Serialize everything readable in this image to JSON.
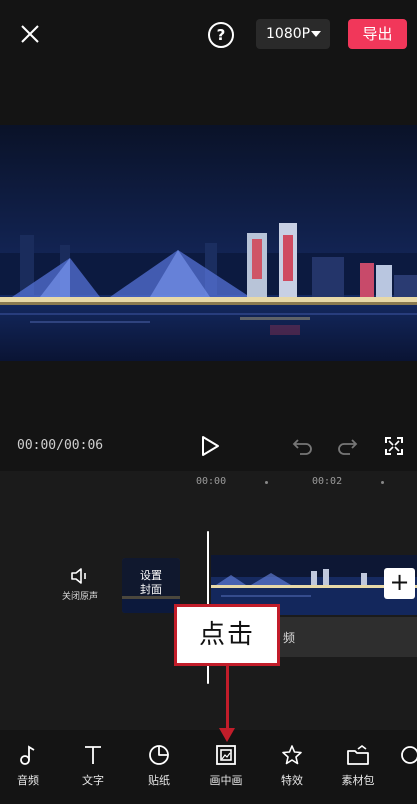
{
  "header": {
    "close_icon": "close-icon",
    "help_icon": "question-circle-icon",
    "help_glyph": "?",
    "resolution": "1080P",
    "export_label": "导出"
  },
  "player": {
    "time": "00:00/00:06",
    "play_icon": "play-icon",
    "undo_icon": "undo-icon",
    "redo_icon": "redo-icon",
    "fullscreen_icon": "fullscreen-icon"
  },
  "timeline": {
    "ruler": [
      "00:00",
      "00:02"
    ],
    "mute_label": "关闭原声",
    "cover_line1": "设置",
    "cover_line2": "封面",
    "add_glyph": "+",
    "audio_track_text": "频"
  },
  "annotation": {
    "callout_text": "点击"
  },
  "toolbar": {
    "items": [
      {
        "label": "音频",
        "icon": "music-note-icon"
      },
      {
        "label": "文字",
        "icon": "text-icon"
      },
      {
        "label": "贴纸",
        "icon": "sticker-icon"
      },
      {
        "label": "画中画",
        "icon": "picture-in-picture-icon"
      },
      {
        "label": "特效",
        "icon": "effects-star-icon"
      },
      {
        "label": "素材包",
        "icon": "material-pack-icon"
      }
    ]
  },
  "colors": {
    "accent": "#f1375a",
    "annotation": "#c21d2a"
  }
}
